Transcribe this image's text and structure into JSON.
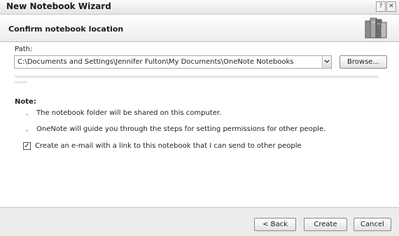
{
  "window": {
    "title": "New Notebook Wizard",
    "help_glyph": "?",
    "close_glyph": "✕"
  },
  "header": {
    "title": "Confirm notebook location",
    "icon": "notebooks-icon"
  },
  "path": {
    "label": "Path:",
    "value": "C:\\Documents and Settings\\Jennifer Fulton\\My Documents\\OneNote Notebooks",
    "dropdown_icon": "chevron-down-icon",
    "browse_label": "Browse..."
  },
  "note": {
    "label": "Note:",
    "items": [
      "The notebook folder will be shared on this computer.",
      "OneNote will guide you through the steps for setting permissions for other people."
    ]
  },
  "email_option": {
    "checked": true,
    "check_glyph": "✓",
    "label": "Create an e-mail with a link to this notebook that I can send to other people"
  },
  "footer": {
    "back_label": "< Back",
    "create_label": "Create",
    "cancel_label": "Cancel"
  },
  "colors": {
    "titlebar": "#e4e4e4",
    "content_bg": "#ffffff",
    "footer_bg": "#ececec",
    "border": "#8a8a8a"
  }
}
